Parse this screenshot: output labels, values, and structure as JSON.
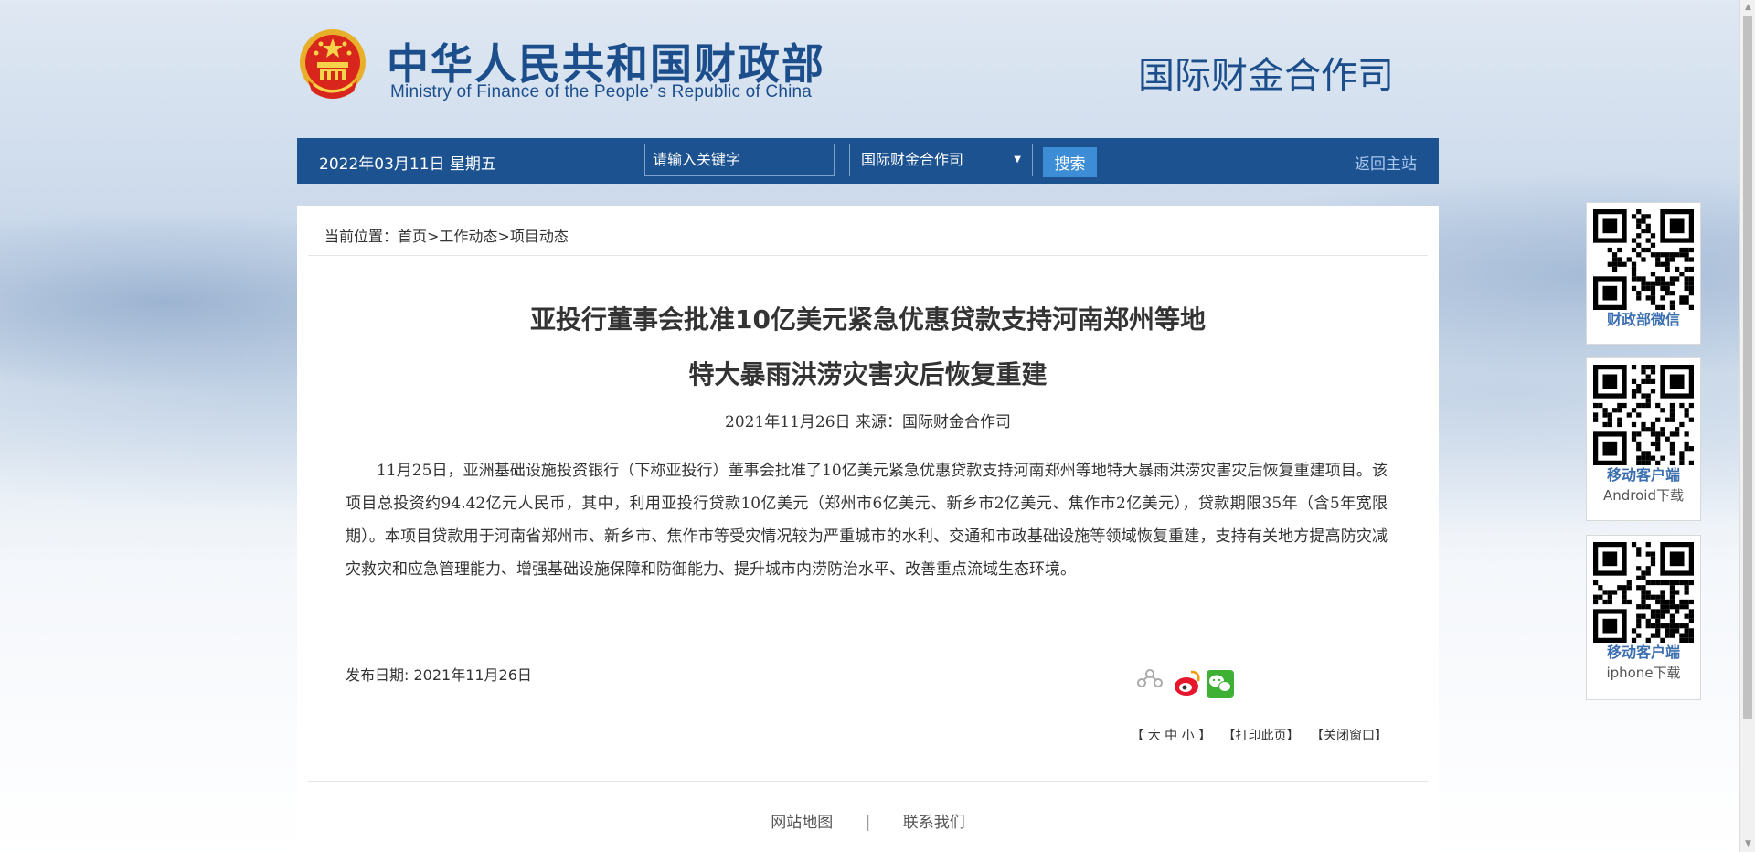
{
  "header": {
    "title_cn": "中华人民共和国财政部",
    "title_en": "Ministry of Finance of the People’ s Republic of China",
    "department": "国际财金合作司"
  },
  "navbar": {
    "date": "2022年03月11日  星期五",
    "search_placeholder": "请输入关键字",
    "scope_selected": "国际财金合作司",
    "search_button": "搜索",
    "back_home": "返回主站"
  },
  "breadcrumb": {
    "prefix": "当前位置：",
    "path": "首页>工作动态>项目动态"
  },
  "article": {
    "title_line1": "亚投行董事会批准10亿美元紧急优惠贷款支持河南郑州等地",
    "title_line2": "特大暴雨洪涝灾害灾后恢复重建",
    "meta": "2021年11月26日  来源：国际财金合作司",
    "body": "11月25日，亚洲基础设施投资银行（下称亚投行）董事会批准了10亿美元紧急优惠贷款支持河南郑州等地特大暴雨洪涝灾害灾后恢复重建项目。该项目总投资约94.42亿元人民币，其中，利用亚投行贷款10亿美元（郑州市6亿美元、新乡市2亿美元、焦作市2亿美元），贷款期限35年（含5年宽限期）。本项目贷款用于河南省郑州市、新乡市、焦作市等受灾情况较为严重城市的水利、交通和市政基础设施等领域恢复重建，支持有关地方提高防灾减灾救灾和应急管理能力、增强基础设施保障和防御能力、提升城市内涝防治水平、改善重点流域生态环境。",
    "pub_date": "发布日期:  2021年11月26日"
  },
  "share": {
    "icons": [
      "share-icon",
      "weibo-icon",
      "wechat-icon"
    ],
    "colors": {
      "share": "#aaaaaa",
      "weibo": "#e6162d",
      "wechat": "#3eb135"
    }
  },
  "tools": {
    "font_size": "【 大 中 小 】",
    "print": "【打印此页】",
    "close": "【关闭窗口】"
  },
  "footer": {
    "sitemap": "网站地图",
    "divider": "|",
    "contact": "联系我们"
  },
  "qr": [
    {
      "title": "财政部微信",
      "sub": ""
    },
    {
      "title": "移动客户端",
      "sub": "Android下载"
    },
    {
      "title": "移动客户端",
      "sub": "iphone下载"
    }
  ],
  "colors": {
    "brand_blue": "#1d4e8c",
    "navbar": "#1c5290",
    "button": "#3c8dd6"
  }
}
